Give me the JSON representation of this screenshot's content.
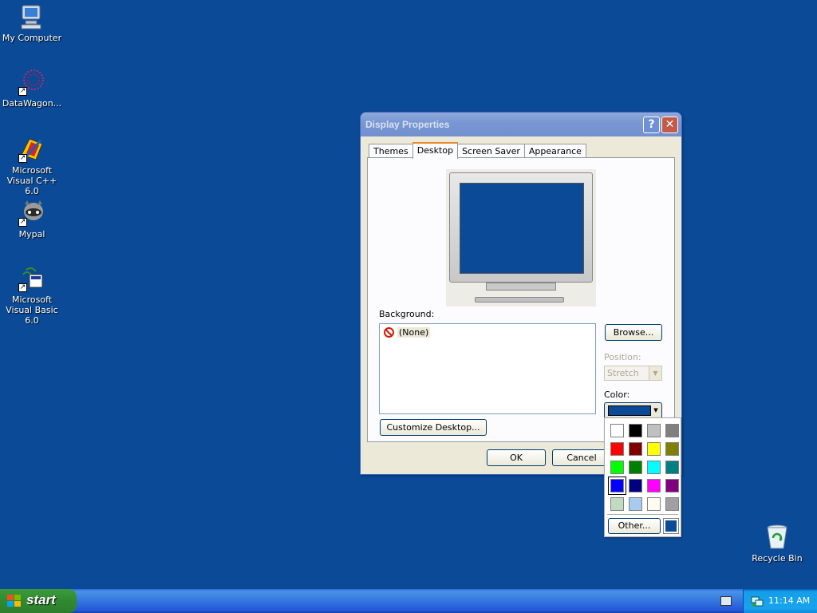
{
  "desktop": {
    "icons": [
      {
        "label": "My Computer",
        "icon": "computer-icon"
      },
      {
        "label": "DataWagon...",
        "icon": "datawagon-icon"
      },
      {
        "label": "Microsoft Visual C++ 6.0",
        "icon": "visual-cpp-icon"
      },
      {
        "label": "Mypal",
        "icon": "mypal-icon"
      },
      {
        "label": "Microsoft Visual Basic 6.0",
        "icon": "visual-basic-icon"
      },
      {
        "label": "Recycle Bin",
        "icon": "recycle-bin-icon"
      }
    ],
    "background_color": "#0a4a97"
  },
  "dialog": {
    "title": "Display Properties",
    "help_glyph": "?",
    "close_glyph": "✕",
    "tabs": [
      {
        "label": "Themes"
      },
      {
        "label": "Desktop"
      },
      {
        "label": "Screen Saver"
      },
      {
        "label": "Appearance"
      }
    ],
    "active_tab": "Desktop",
    "background_label": "Background:",
    "background_items": [
      {
        "label": "(None)",
        "icon": "no-entry-icon"
      }
    ],
    "browse_label": "Browse...",
    "position_label": "Position:",
    "position_value": "Stretch",
    "color_label": "Color:",
    "customize_label": "Customize Desktop...",
    "ok_label": "OK",
    "cancel_label": "Cancel"
  },
  "color_picker": {
    "swatches": [
      "#ffffff",
      "#000000",
      "#c0c0c0",
      "#808080",
      "#ff0000",
      "#800000",
      "#ffff00",
      "#808000",
      "#00ff00",
      "#008000",
      "#00ffff",
      "#008080",
      "#0000ff",
      "#000080",
      "#ff00ff",
      "#800080",
      "#c0dcc0",
      "#a6caf0",
      "#fffbf0",
      "#a0a0a4"
    ],
    "selected_color": "#0000ff",
    "current_color": "#0a4a97",
    "other_label": "Other..."
  },
  "taskbar": {
    "start_label": "start",
    "time": "11:14 AM"
  }
}
